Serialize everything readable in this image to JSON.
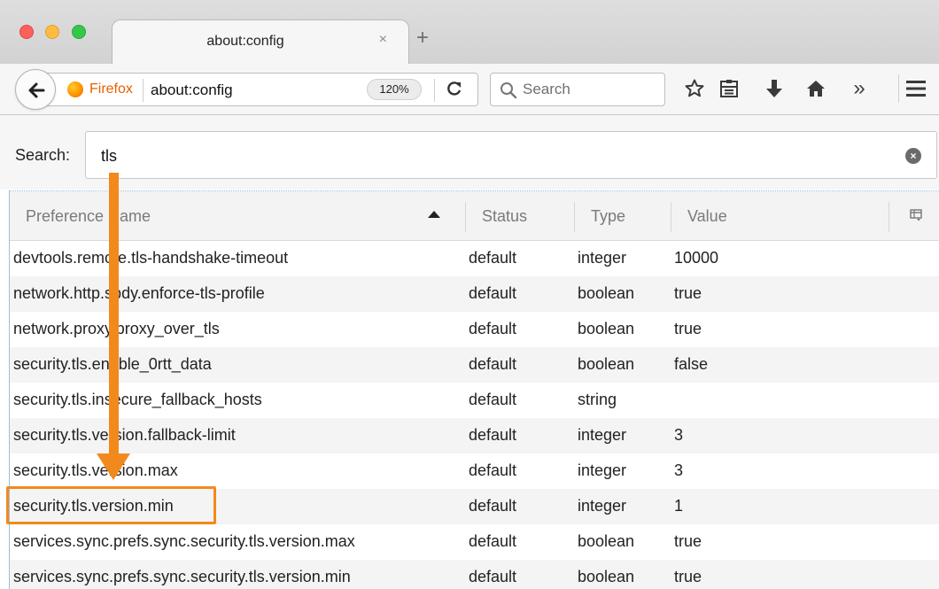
{
  "tab": {
    "title": "about:config",
    "close_glyph": "×",
    "new_tab_glyph": "+"
  },
  "navbar": {
    "identity_label": "Firefox",
    "url": "about:config",
    "zoom": "120%",
    "search_placeholder": "Search",
    "icons": [
      "back-arrow-icon",
      "firefox-logo-icon",
      "reload-icon",
      "search-icon",
      "bookmark-star-icon",
      "reading-list-icon",
      "download-icon",
      "home-icon",
      "overflow-chevron-icon",
      "hamburger-menu-icon"
    ],
    "overflow_glyph": "»",
    "reload_glyph": "C"
  },
  "config": {
    "search_label": "Search:",
    "filter_value": "tls",
    "clear_glyph": "×",
    "columns": {
      "name": "Preference Name",
      "status": "Status",
      "type": "Type",
      "value": "Value"
    },
    "rows": [
      {
        "name": "devtools.remote.tls-handshake-timeout",
        "status": "default",
        "type": "integer",
        "value": "10000"
      },
      {
        "name": "network.http.spdy.enforce-tls-profile",
        "status": "default",
        "type": "boolean",
        "value": "true"
      },
      {
        "name": "network.proxy.proxy_over_tls",
        "status": "default",
        "type": "boolean",
        "value": "true"
      },
      {
        "name": "security.tls.enable_0rtt_data",
        "status": "default",
        "type": "boolean",
        "value": "false"
      },
      {
        "name": "security.tls.insecure_fallback_hosts",
        "status": "default",
        "type": "string",
        "value": ""
      },
      {
        "name": "security.tls.version.fallback-limit",
        "status": "default",
        "type": "integer",
        "value": "3"
      },
      {
        "name": "security.tls.version.max",
        "status": "default",
        "type": "integer",
        "value": "3"
      },
      {
        "name": "security.tls.version.min",
        "status": "default",
        "type": "integer",
        "value": "1"
      },
      {
        "name": "services.sync.prefs.sync.security.tls.version.max",
        "status": "default",
        "type": "boolean",
        "value": "true"
      },
      {
        "name": "services.sync.prefs.sync.security.tls.version.min",
        "status": "default",
        "type": "boolean",
        "value": "true"
      }
    ]
  },
  "annotation": {
    "color": "#f2891d",
    "highlighted_row": "security.tls.version.min"
  },
  "colors": {
    "accent_orange": "#f2891d",
    "firefox_orange": "#e66000",
    "traffic_red": "#fc605c",
    "traffic_yellow": "#fdbc40",
    "traffic_green": "#34c84a"
  }
}
